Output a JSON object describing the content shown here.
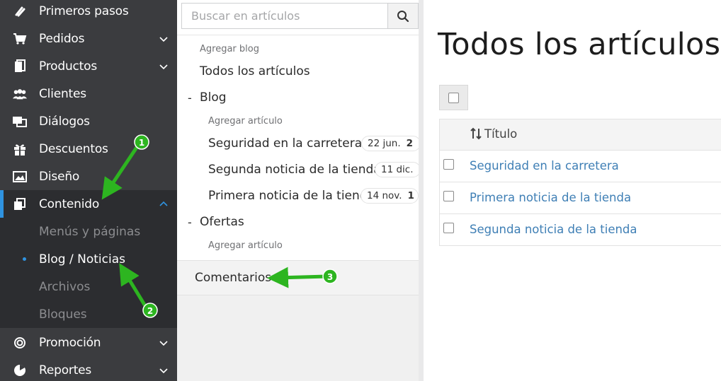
{
  "sidebar": {
    "items": [
      {
        "label": "Primeros pasos",
        "icon": "rocket-icon"
      },
      {
        "label": "Pedidos",
        "icon": "cart-icon"
      },
      {
        "label": "Productos",
        "icon": "book-icon"
      },
      {
        "label": "Clientes",
        "icon": "users-icon"
      },
      {
        "label": "Diálogos",
        "icon": "chat-icon"
      },
      {
        "label": "Descuentos",
        "icon": "gift-icon"
      },
      {
        "label": "Diseño",
        "icon": "image-icon"
      },
      {
        "label": "Contenido",
        "icon": "pages-icon"
      },
      {
        "label": "Promoción",
        "icon": "target-icon"
      },
      {
        "label": "Reportes",
        "icon": "pie-chart-icon"
      }
    ],
    "content_sub": [
      "Menús y páginas",
      "Blog / Noticias",
      "Archivos",
      "Bloques"
    ],
    "accent_color": "#2f93e0"
  },
  "middle": {
    "search_placeholder": "Buscar en artículos",
    "add_blog": "Agregar blog",
    "all_articles": "Todos los artículos",
    "blog_dash": "-",
    "blog_name": "Blog",
    "add_article": "Agregar artículo",
    "articles": [
      {
        "title": "Seguridad en la carretera",
        "date": "22 jun.",
        "count": "2"
      },
      {
        "title": "Segunda noticia de la tienda",
        "date": "11 dic.",
        "count": ""
      },
      {
        "title": "Primera noticia de la tienda",
        "date": "14 nov.",
        "count": "1"
      }
    ],
    "offers_dash": "-",
    "offers_name": "Ofertas",
    "offers_add_article": "Agregar artículo",
    "comments": "Comentarios"
  },
  "main": {
    "title": "Todos los artículos",
    "column_title": "Título",
    "rows": [
      "Seguridad en la carretera",
      "Primera noticia de la tienda",
      "Segunda noticia de la tienda"
    ],
    "link_color": "#3f7fb5"
  },
  "annotations": {
    "markers": [
      "1",
      "2",
      "3"
    ],
    "color": "#2db520"
  }
}
